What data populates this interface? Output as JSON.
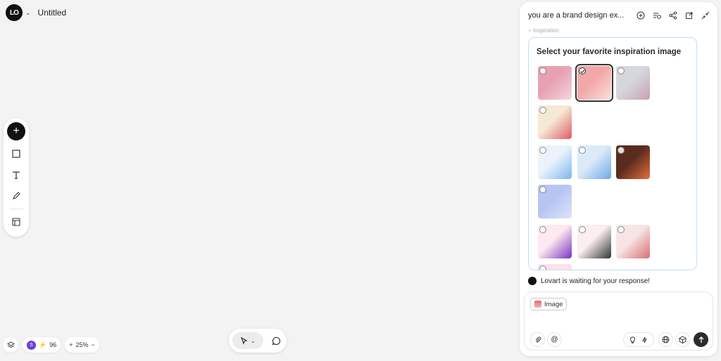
{
  "header": {
    "logo_text": "LO",
    "title": "Untitled"
  },
  "bottom_left": {
    "avatar_letter": "S",
    "credits": "96",
    "zoom": "25%",
    "zoom_in": "+",
    "zoom_out": "−"
  },
  "panel": {
    "title": "you are a brand design ex...",
    "section_label": "Inspiration",
    "card_title": "Select your favorite inspiration image",
    "waiting_text": "Lovart is waiting for your response!",
    "attachment_label": "Image"
  },
  "thumbnails": [
    {
      "id": "t1",
      "selected": false,
      "colors": [
        "#e7a1b3",
        "#f6d6dd"
      ]
    },
    {
      "id": "t2",
      "selected": true,
      "colors": [
        "#f2a8a8",
        "#fbe0dc"
      ]
    },
    {
      "id": "t3",
      "selected": false,
      "colors": [
        "#d5d7dc",
        "#c9a0b4"
      ]
    },
    {
      "id": "t4",
      "selected": false,
      "colors": [
        "#f5e9d5",
        "#e05a66"
      ]
    },
    {
      "id": "t5",
      "selected": false,
      "colors": [
        "#eaf3fc",
        "#7fb5ea"
      ]
    },
    {
      "id": "t6",
      "selected": false,
      "colors": [
        "#dbeaf9",
        "#6fa9e6"
      ]
    },
    {
      "id": "t7",
      "selected": false,
      "colors": [
        "#5a2b1e",
        "#e3703a"
      ]
    },
    {
      "id": "t8",
      "selected": false,
      "colors": [
        "#b7c5f3",
        "#dde3fb"
      ]
    },
    {
      "id": "t9",
      "selected": false,
      "colors": [
        "#fde9ef",
        "#7a2fc7"
      ]
    },
    {
      "id": "t10",
      "selected": false,
      "colors": [
        "#fbeeee",
        "#333"
      ]
    },
    {
      "id": "t11",
      "selected": false,
      "colors": [
        "#f7e5e5",
        "#d96e72"
      ]
    },
    {
      "id": "t12",
      "selected": false,
      "colors": [
        "#fbe3ea",
        "#f2c6d3"
      ]
    }
  ]
}
